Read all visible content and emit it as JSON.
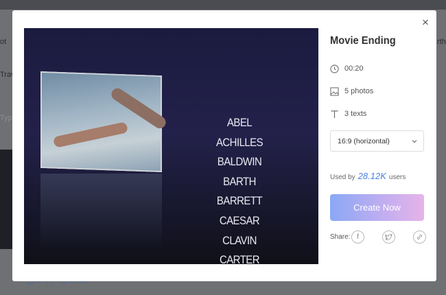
{
  "background": {
    "side_labels": [
      "ot",
      "Trave",
      "Typ"
    ],
    "right_label": "rtho",
    "bottom_stats": [
      {
        "icon": "image-icon",
        "value": "9"
      },
      {
        "icon": "text-icon",
        "value": "9"
      },
      {
        "icon": "clock-icon",
        "value": "01:12"
      }
    ]
  },
  "modal": {
    "close_label": "×",
    "preview": {
      "credits": [
        "ABEL",
        "ACHILLES",
        "BALDWIN",
        "BARTH",
        "BARRETT",
        "CAESAR",
        "CLAVIN",
        "CARTER"
      ]
    },
    "info": {
      "title": "Movie Ending",
      "duration": "00:20",
      "photos": "5 photos",
      "texts": "3 texts",
      "aspect_ratio": "16:9 (horizontal)",
      "used_prefix": "Used by",
      "used_count": "28.12K",
      "used_suffix": "users",
      "create_label": "Create Now",
      "share_label": "Share:"
    }
  },
  "colors": {
    "accent_gradient_start": "#8aa8f5",
    "accent_gradient_end": "#e6b3e8",
    "used_count": "#4a7fe0"
  }
}
